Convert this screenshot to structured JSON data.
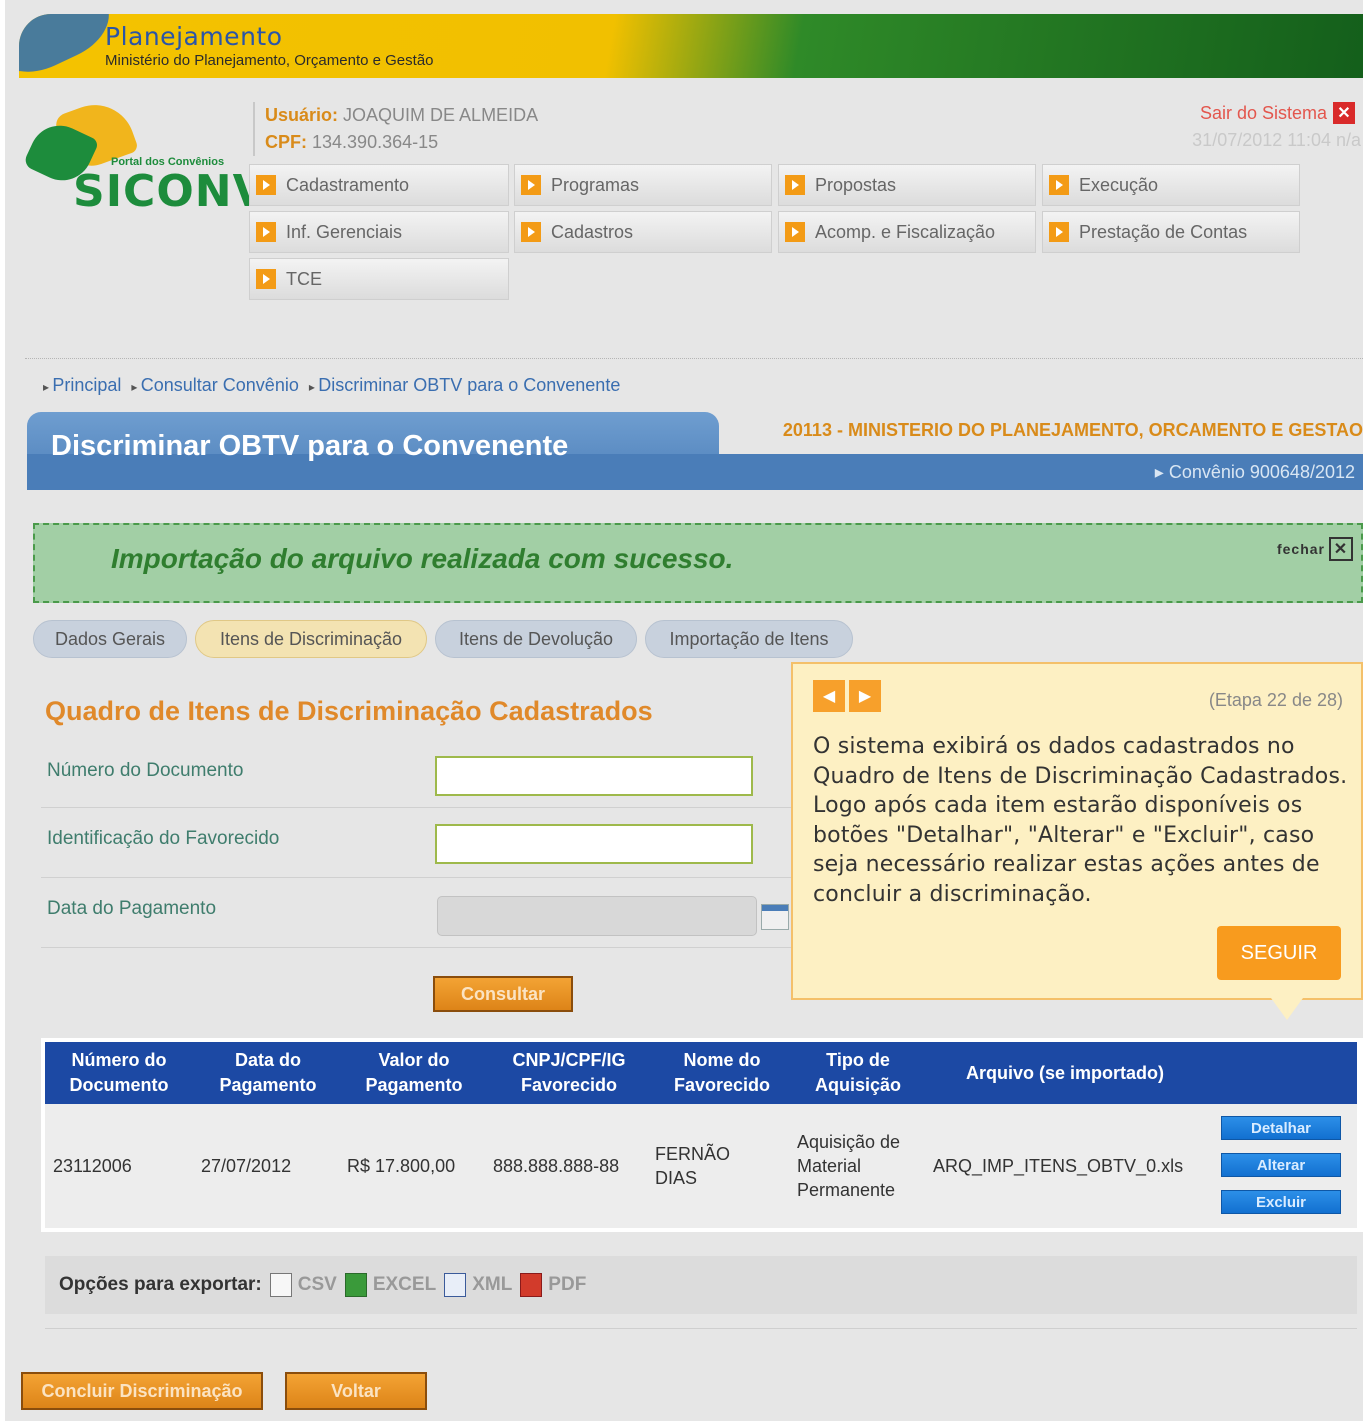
{
  "banner": {
    "title": "Planejamento",
    "subtitle": "Ministério do Planejamento, Orçamento e Gestão"
  },
  "logo": {
    "portal": "Portal dos Convênios",
    "name": "SICONV"
  },
  "user": {
    "label_user": "Usuário:",
    "name": "JOAQUIM DE ALMEIDA",
    "label_cpf": "CPF:",
    "cpf": "134.390.364-15"
  },
  "logout": {
    "label": "Sair do Sistema",
    "icon": "close-icon",
    "datetime": "31/07/2012 11:04 n/a"
  },
  "menu": [
    "Cadastramento",
    "Programas",
    "Propostas",
    "Execução",
    "Inf. Gerenciais",
    "Cadastros",
    "Acomp. e Fiscalização",
    "Prestação de Contas",
    "TCE"
  ],
  "breadcrumb": [
    "Principal",
    "Consultar Convênio",
    "Discriminar OBTV para o Convenente"
  ],
  "page": {
    "title": "Discriminar OBTV para o Convenente",
    "org": "20113 - MINISTERIO DO PLANEJAMENTO, ORCAMENTO E GESTAO",
    "convenio": "▸ Convênio 900648/2012"
  },
  "success": {
    "message": "Importação do arquivo realizada com sucesso.",
    "close_label": "fechar"
  },
  "tabs": [
    "Dados Gerais",
    "Itens de Discriminação",
    "Itens de Devolução",
    "Importação de Itens"
  ],
  "section_title": "Quadro de Itens de Discriminação Cadastrados",
  "form": {
    "numero_label": "Número do Documento",
    "numero_value": "",
    "ident_label": "Identificação do Favorecido",
    "ident_value": "",
    "data_label": "Data do Pagamento",
    "data_value": "",
    "consultar": "Consultar"
  },
  "tooltip": {
    "step": "(Etapa 22 de 28)",
    "text": "O sistema exibirá os dados cadastrados no Quadro de Itens de Discriminação Cadastrados. Logo após cada item estarão disponíveis os botões \"Detalhar\", \"Alterar\" e \"Excluir\", caso seja necessário realizar estas ações antes de concluir a discriminação.",
    "seguir": "SEGUIR"
  },
  "table": {
    "headers": [
      "Número do\nDocumento",
      "Data do\nPagamento",
      "Valor do\nPagamento",
      "CNPJ/CPF/IG\nFavorecido",
      "Nome do\nFavorecido",
      "Tipo de\nAquisição",
      "Arquivo (se importado)"
    ],
    "row": {
      "numero": "23112006",
      "data": "27/07/2012",
      "valor": "R$ 17.800,00",
      "cnpj": "888.888.888-88",
      "nome": "FERNÃO DIAS",
      "tipo": "Aquisição de Material Permanente",
      "arquivo": "ARQ_IMP_ITENS_OBTV_0.xls"
    },
    "actions": {
      "detalhar": "Detalhar",
      "alterar": "Alterar",
      "excluir": "Excluir"
    }
  },
  "export": {
    "label": "Opções para exportar:",
    "csv": "CSV",
    "excel": "EXCEL",
    "xml": "XML",
    "pdf": "PDF"
  },
  "footer": {
    "concluir": "Concluir Discriminação",
    "voltar": "Voltar"
  }
}
